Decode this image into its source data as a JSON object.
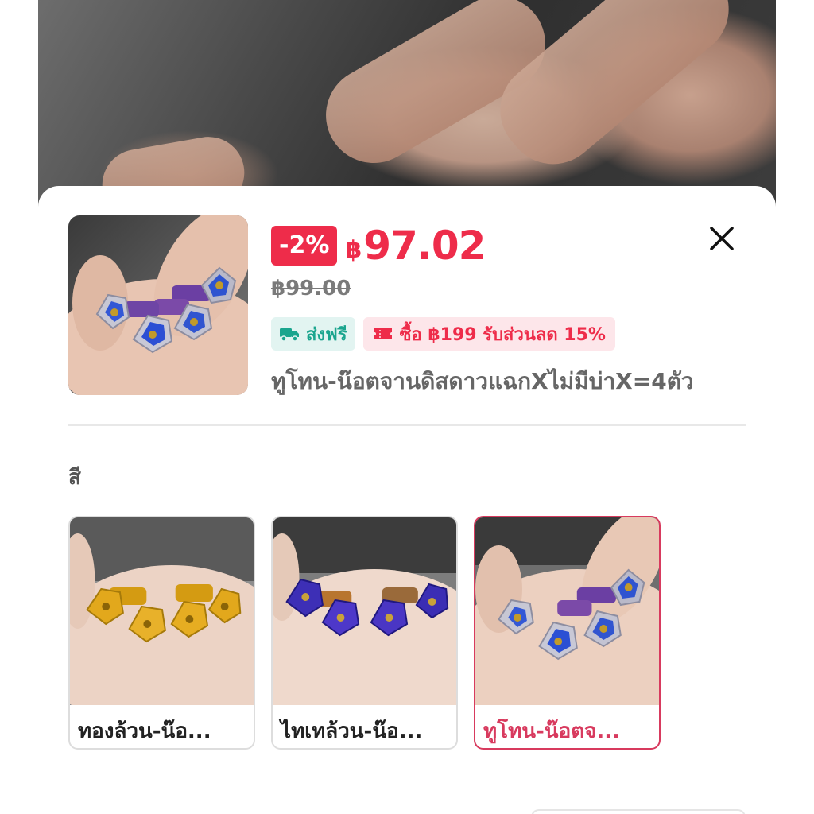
{
  "product": {
    "discount_badge": "-2%",
    "currency": "฿",
    "price": "97.02",
    "original_price": "฿99.00",
    "title": "ทูโทน-น๊อตจานดิสดาวแฉกXไม่มีบ่าX=4ตัว",
    "shipping_tag": "ส่งฟรี",
    "coupon_tag": "ซื้อ ฿199 รับส่วนลด 15%",
    "image_icon": "bolts-photo"
  },
  "variants": {
    "section_label": "สี",
    "items": [
      {
        "label": "ทองล้วน-น๊อ...",
        "selected": false,
        "bolt_color": "#e2a81c"
      },
      {
        "label": "ไทเทล้วน-น๊อ...",
        "selected": false,
        "bolt_color": "#4a3ac7"
      },
      {
        "label": "ทูโทน-น๊อตจ...",
        "selected": true,
        "bolt_color": "#3b5fd8"
      }
    ]
  },
  "colors": {
    "accent": "#ee2c4a",
    "selected_border": "#d83a5e",
    "shipping_text": "#1aa58e",
    "shipping_bg": "#e2f4f1",
    "coupon_bg": "#fde6ea"
  },
  "icons": {
    "close": "close-icon",
    "truck": "truck-icon",
    "ticket": "ticket-icon"
  }
}
